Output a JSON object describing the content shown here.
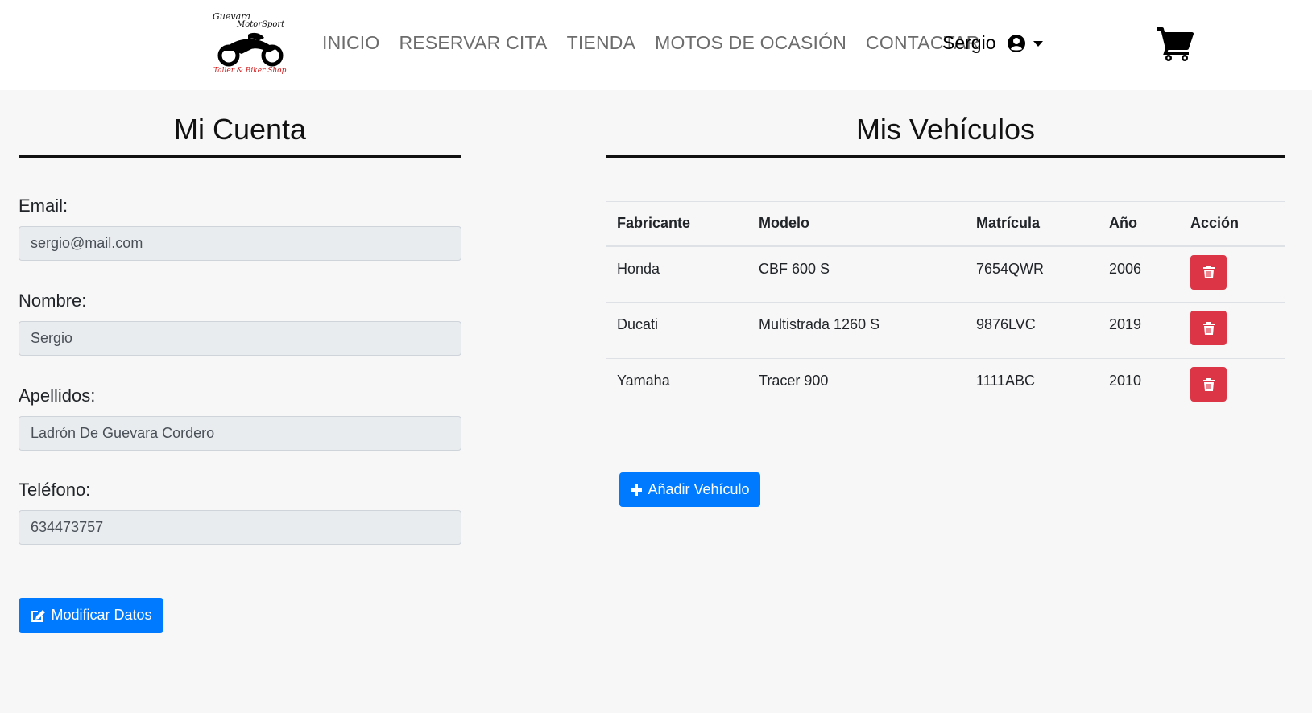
{
  "navbar": {
    "logo": {
      "line1": "Guevara",
      "line2": "MotorSport",
      "line3": "Taller & Biker Shop"
    },
    "links": [
      "INICIO",
      "RESERVAR CITA",
      "TIENDA",
      "MOTOS DE OCASIÓN",
      "CONTACTAR"
    ],
    "user": "Sergio"
  },
  "account": {
    "title": "Mi Cuenta",
    "fields": [
      {
        "label": "Email:",
        "value": "sergio@mail.com"
      },
      {
        "label": "Nombre:",
        "value": "Sergio"
      },
      {
        "label": "Apellidos:",
        "value": "Ladrón De Guevara Cordero"
      },
      {
        "label": "Teléfono:",
        "value": "634473757"
      }
    ],
    "modify_label": "Modificar Datos"
  },
  "vehicles": {
    "title": "Mis Vehículos",
    "headers": [
      "Fabricante",
      "Modelo",
      "Matrícula",
      "Año",
      "Acción"
    ],
    "rows": [
      [
        "Honda",
        "CBF 600 S",
        "7654QWR",
        "2006"
      ],
      [
        "Ducati",
        "Multistrada 1260 S",
        "9876LVC",
        "2019"
      ],
      [
        "Yamaha",
        "Tracer 900",
        "1111ABC",
        "2010"
      ]
    ],
    "add_label": "Añadir Vehículo"
  },
  "colors": {
    "primary": "#007bff",
    "danger": "#dc3545",
    "field_bg": "#e9ecef",
    "page_bg": "#f7f7f7"
  }
}
